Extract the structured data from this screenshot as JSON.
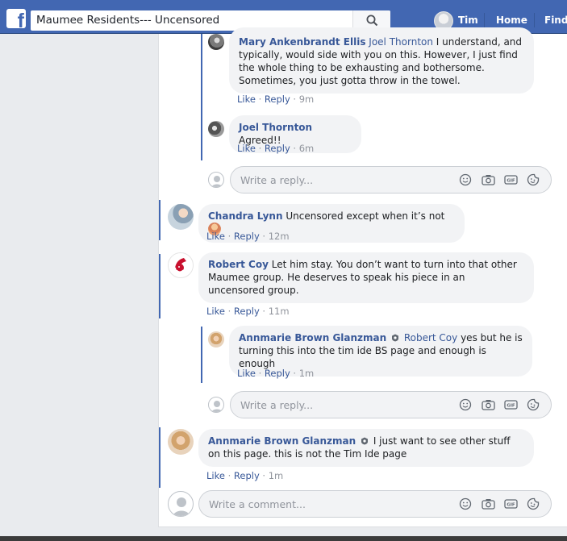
{
  "topbar": {
    "logo_letter": "f",
    "search_text": "Maumee Residents--- Uncensored",
    "user_name": "Tim",
    "home_label": "Home",
    "find_label": "Find"
  },
  "comments": [
    {
      "author": "Mary Ankenbrandt Ellis",
      "mention": "Joel Thornton",
      "text": "I understand, and typically, would side with you on this. However, I just find the whole thing to be exhausting and bothersome. Sometimes, you just gotta throw in the towel.",
      "like": "Like",
      "reply": "Reply",
      "sep": "·",
      "time": "9m"
    },
    {
      "author": "Joel Thornton",
      "text": "Agreed!!",
      "like": "Like",
      "reply": "Reply",
      "sep": "·",
      "time": "6m"
    },
    {
      "author": "Chandra Lynn",
      "text": "Uncensored except when it’s not",
      "like": "Like",
      "reply": "Reply",
      "sep": "·",
      "time": "12m"
    },
    {
      "author": "Robert Coy",
      "text": "Let him stay. You don’t want to turn into that other Maumee group. He deserves to speak his piece in an uncensored group.",
      "like": "Like",
      "reply": "Reply",
      "sep": "·",
      "time": "11m"
    },
    {
      "author": "Annmarie Brown Glanzman",
      "mention": "Robert Coy",
      "text": "yes but he is turning this into the tim ide BS page and enough is enough",
      "like": "Like",
      "reply": "Reply",
      "sep": "·",
      "time": "1m"
    },
    {
      "author": "Annmarie Brown Glanzman",
      "text": "I just want to see other stuff on this page. this is not the Tim Ide page",
      "like": "Like",
      "reply": "Reply",
      "sep": "·",
      "time": "1m"
    }
  ],
  "inputs": {
    "reply_placeholder": "Write a reply...",
    "comment_placeholder": "Write a comment...",
    "gif_label": "GIF"
  },
  "colors": {
    "brand": "#4267b2",
    "link": "#385898",
    "bubble": "#f2f3f5"
  },
  "icons": [
    "facebook-logo-icon",
    "search-icon",
    "emoji-icon",
    "camera-icon",
    "gif-icon",
    "sticker-icon",
    "admin-badge-icon",
    "user-placeholder-icon"
  ]
}
